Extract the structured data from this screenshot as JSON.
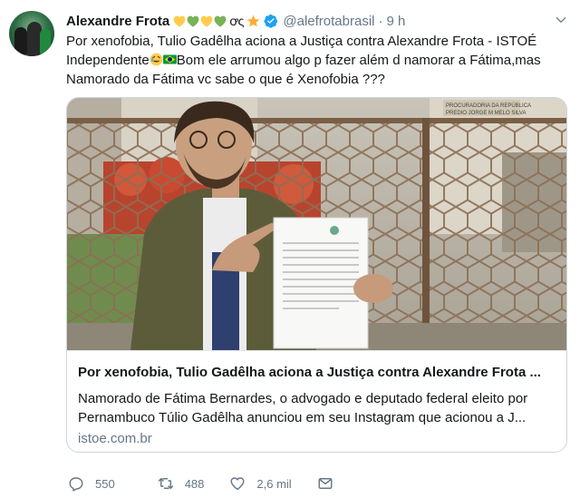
{
  "tweet": {
    "author_name": "Alexandre Frota",
    "name_suffix": "ꝍς",
    "handle": "@alefrotabrasil",
    "separator": "·",
    "time": "9 h",
    "text_part1": "Por xenofobia, Tulio Gadêlha aciona a Justiça contra Alexandre Frota - ISTOÉ Independente",
    "text_part2": "Bom ele arrumou algo p fazer além d namorar a Fátima,mas Namorado da Fátima vc sabe o que é Xenofobia ???",
    "emojis_name": [
      "yellow-heart",
      "green-heart",
      "yellow-heart",
      "green-heart"
    ],
    "emojis_text": [
      "rolling-laughing",
      "brazil-flag"
    ]
  },
  "card": {
    "title": "Por xenofobia, Tulio Gadêlha aciona a Justiça contra Alexandre Frota ...",
    "description": "Namorado de Fátima Bernardes, o advogado e deputado federal eleito por Pernambuco Túlio Gadêlha anunciou em seu Instagram que acionou a J...",
    "domain": "istoe.com.br",
    "image_sign": "PROCURADORIA DA REPÚBLICA",
    "image_sign2": "PREDIO JORGE M MELO SILVA"
  },
  "actions": {
    "replies": "550",
    "retweets": "488",
    "likes": "2,6 mil"
  },
  "colors": {
    "text": "#14171a",
    "secondary": "#657786",
    "border": "#ccd6dd",
    "verified": "#1da1f2"
  }
}
